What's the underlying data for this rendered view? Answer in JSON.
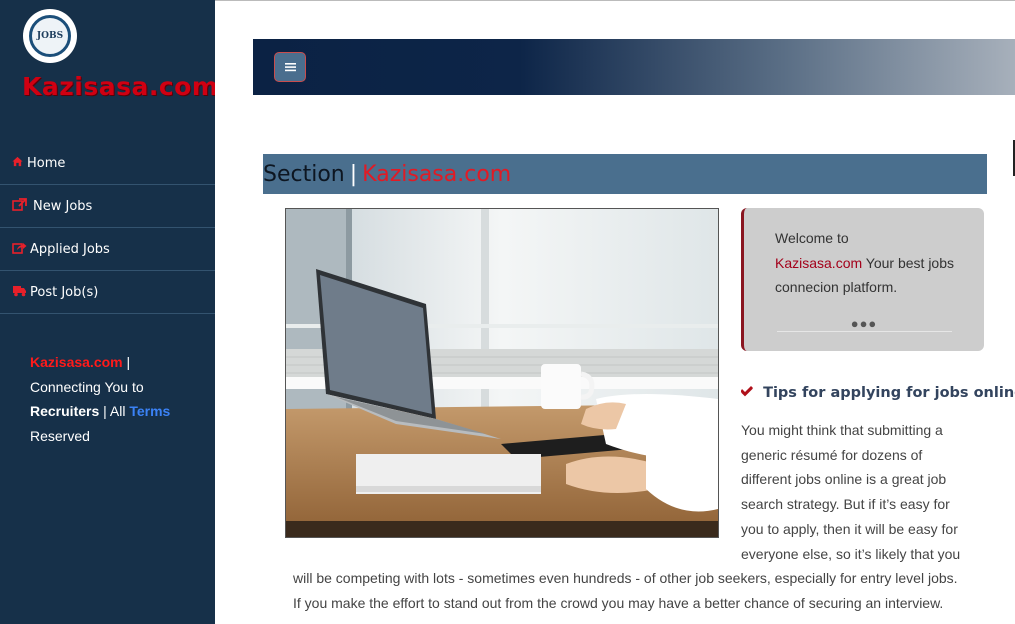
{
  "brand": {
    "logo_text": "JOBS",
    "name": "Kazisasa.com"
  },
  "nav": {
    "items": [
      {
        "label": "Home",
        "icon": "home-icon"
      },
      {
        "label": "New Jobs",
        "icon": "external-link-icon"
      },
      {
        "label": "Applied Jobs",
        "icon": "share-icon"
      },
      {
        "label": "Post Job(s)",
        "icon": "truck-icon"
      }
    ]
  },
  "footer": {
    "site": "Kazisasa.com",
    "pipe": " |",
    "connecting": "Connecting You to",
    "recruiters": "Recruiters",
    "all": " | All ",
    "terms": "Terms",
    "reserved": "Reserved"
  },
  "header": {
    "menu_icon": "menu-icon"
  },
  "section": {
    "label": "Section",
    "separator": "|",
    "site": "Kazisasa.com"
  },
  "welcome": {
    "line1": "Welcome to",
    "site": "Kazisasa.com",
    "rest": " Your best jobs connecion platform.",
    "dots": "●●●"
  },
  "tips": {
    "heading": "Tips for applying for jobs online",
    "body_narrow": "You might think that submitting a generic résumé for dozens of different jobs online is a great job search strategy. But if it’s easy for you to apply, then it will be easy for everyone else, so it’s likely that you",
    "body_wide_1": "will be competing with lots - sometimes even hundreds - of other job seekers, especially for entry level jobs.",
    "body_wide_2": "If you make the effort to stand out from the crowd you may have a better chance of securing an interview."
  },
  "colors": {
    "sidebar_bg": "#163049",
    "accent_red": "#e21a24",
    "section_bar": "#4a6f8e"
  }
}
